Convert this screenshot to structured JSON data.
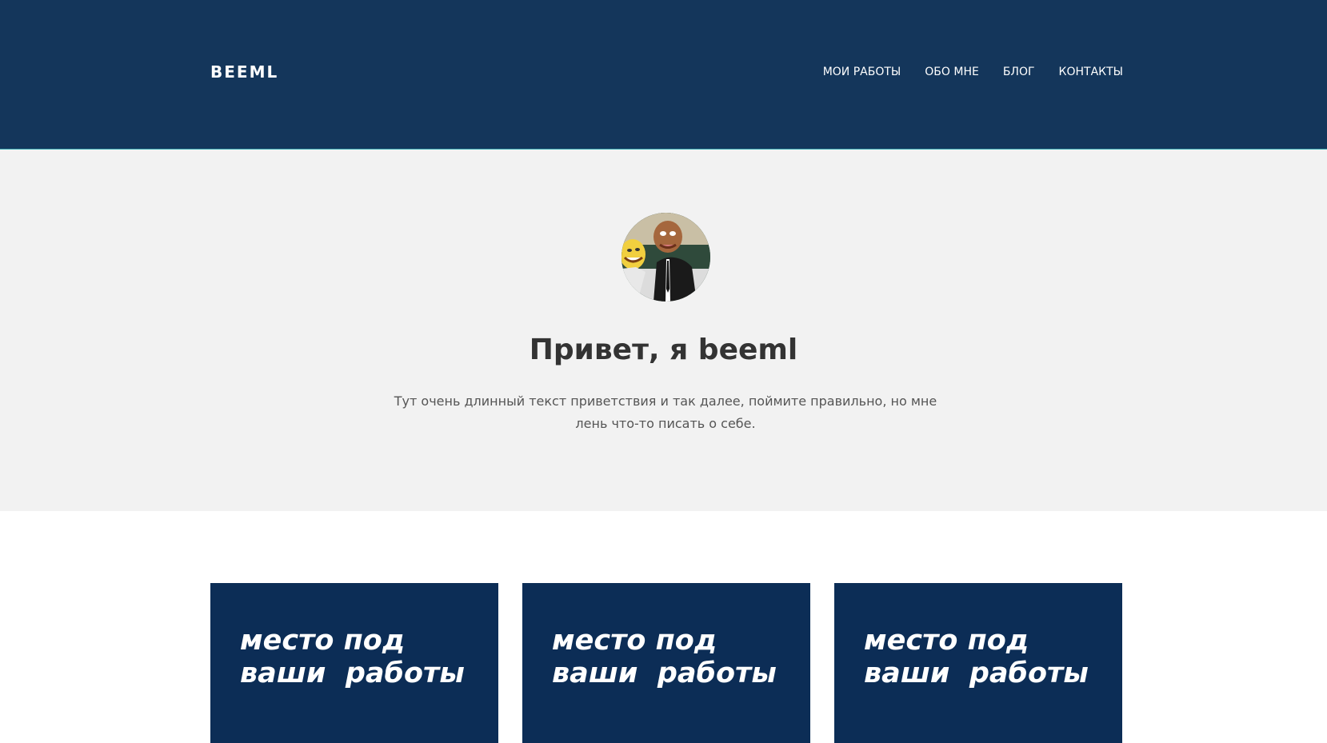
{
  "header": {
    "logo": "BEEML",
    "nav": [
      {
        "label": "МОИ РАБОТЫ"
      },
      {
        "label": "ОБО МНЕ"
      },
      {
        "label": "БЛОГ"
      },
      {
        "label": "КОНТАКТЫ"
      }
    ]
  },
  "hero": {
    "title": "Привет, я beeml",
    "text": "Тут очень длинный текст приветствия и так далее, поймите правильно, но мне лень что-то писать о себе."
  },
  "cards": [
    {
      "text": "место под\nваши  работы"
    },
    {
      "text": "место под\nваши  работы"
    },
    {
      "text": "место под\nваши  работы"
    }
  ],
  "colors": {
    "header_bg": "#14365b",
    "hero_bg": "#f2f2f2",
    "card_bg": "#0c2d56",
    "accent_line": "#3fb0b6"
  }
}
